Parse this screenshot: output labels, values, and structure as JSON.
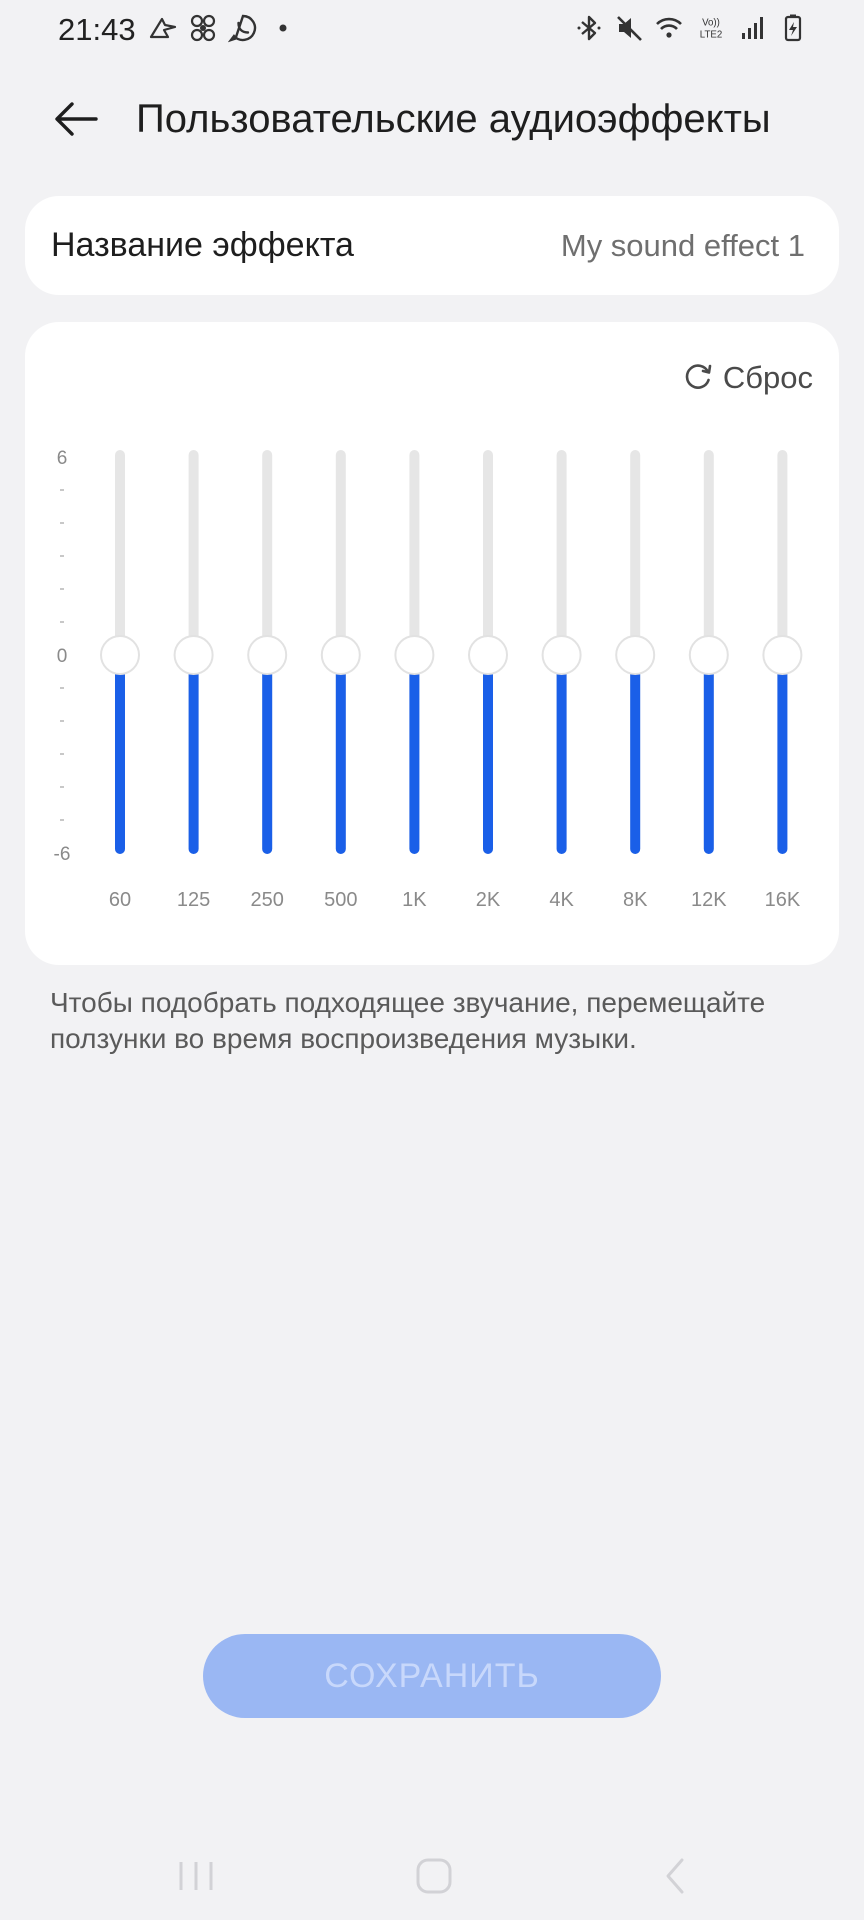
{
  "status_bar": {
    "time": "21:43",
    "left_icons": [
      "notification-app-icon",
      "fan-app-icon",
      "whatsapp-icon",
      "dot-icon"
    ],
    "right_icons": [
      "bluetooth-icon",
      "mute-icon",
      "wifi-icon",
      "volte-lte2-icon",
      "signal-icon",
      "battery-charging-icon"
    ],
    "network_label_top": "Vo))",
    "network_label_bottom": "LTE2"
  },
  "header": {
    "back_icon": "arrow-left-icon",
    "title": "Пользовательские аудиоэффекты"
  },
  "effect_name": {
    "label": "Название эффекта",
    "value": "My sound effect 1"
  },
  "equalizer": {
    "reset_label": "Сброс",
    "reset_icon": "refresh-icon",
    "y_max_label": "6",
    "y_zero_label": "0",
    "y_min_label": "-6",
    "accent_color": "#1a5fe8",
    "track_color": "#e6e6e6",
    "bands": [
      {
        "label": "60",
        "value": 0
      },
      {
        "label": "125",
        "value": 0
      },
      {
        "label": "250",
        "value": 0
      },
      {
        "label": "500",
        "value": 0
      },
      {
        "label": "1K",
        "value": 0
      },
      {
        "label": "2K",
        "value": 0
      },
      {
        "label": "4K",
        "value": 0
      },
      {
        "label": "8K",
        "value": 0
      },
      {
        "label": "12K",
        "value": 0
      },
      {
        "label": "16K",
        "value": 0
      }
    ]
  },
  "hint": "Чтобы подобрать подходящее звучание, перемещайте ползунки во время воспроизведения музыки.",
  "save_button": {
    "label": "СОХРАНИТЬ",
    "color": "#9ab7f3"
  },
  "nav_bar": {
    "icons": [
      "recent-apps-icon",
      "home-icon",
      "back-icon"
    ]
  }
}
